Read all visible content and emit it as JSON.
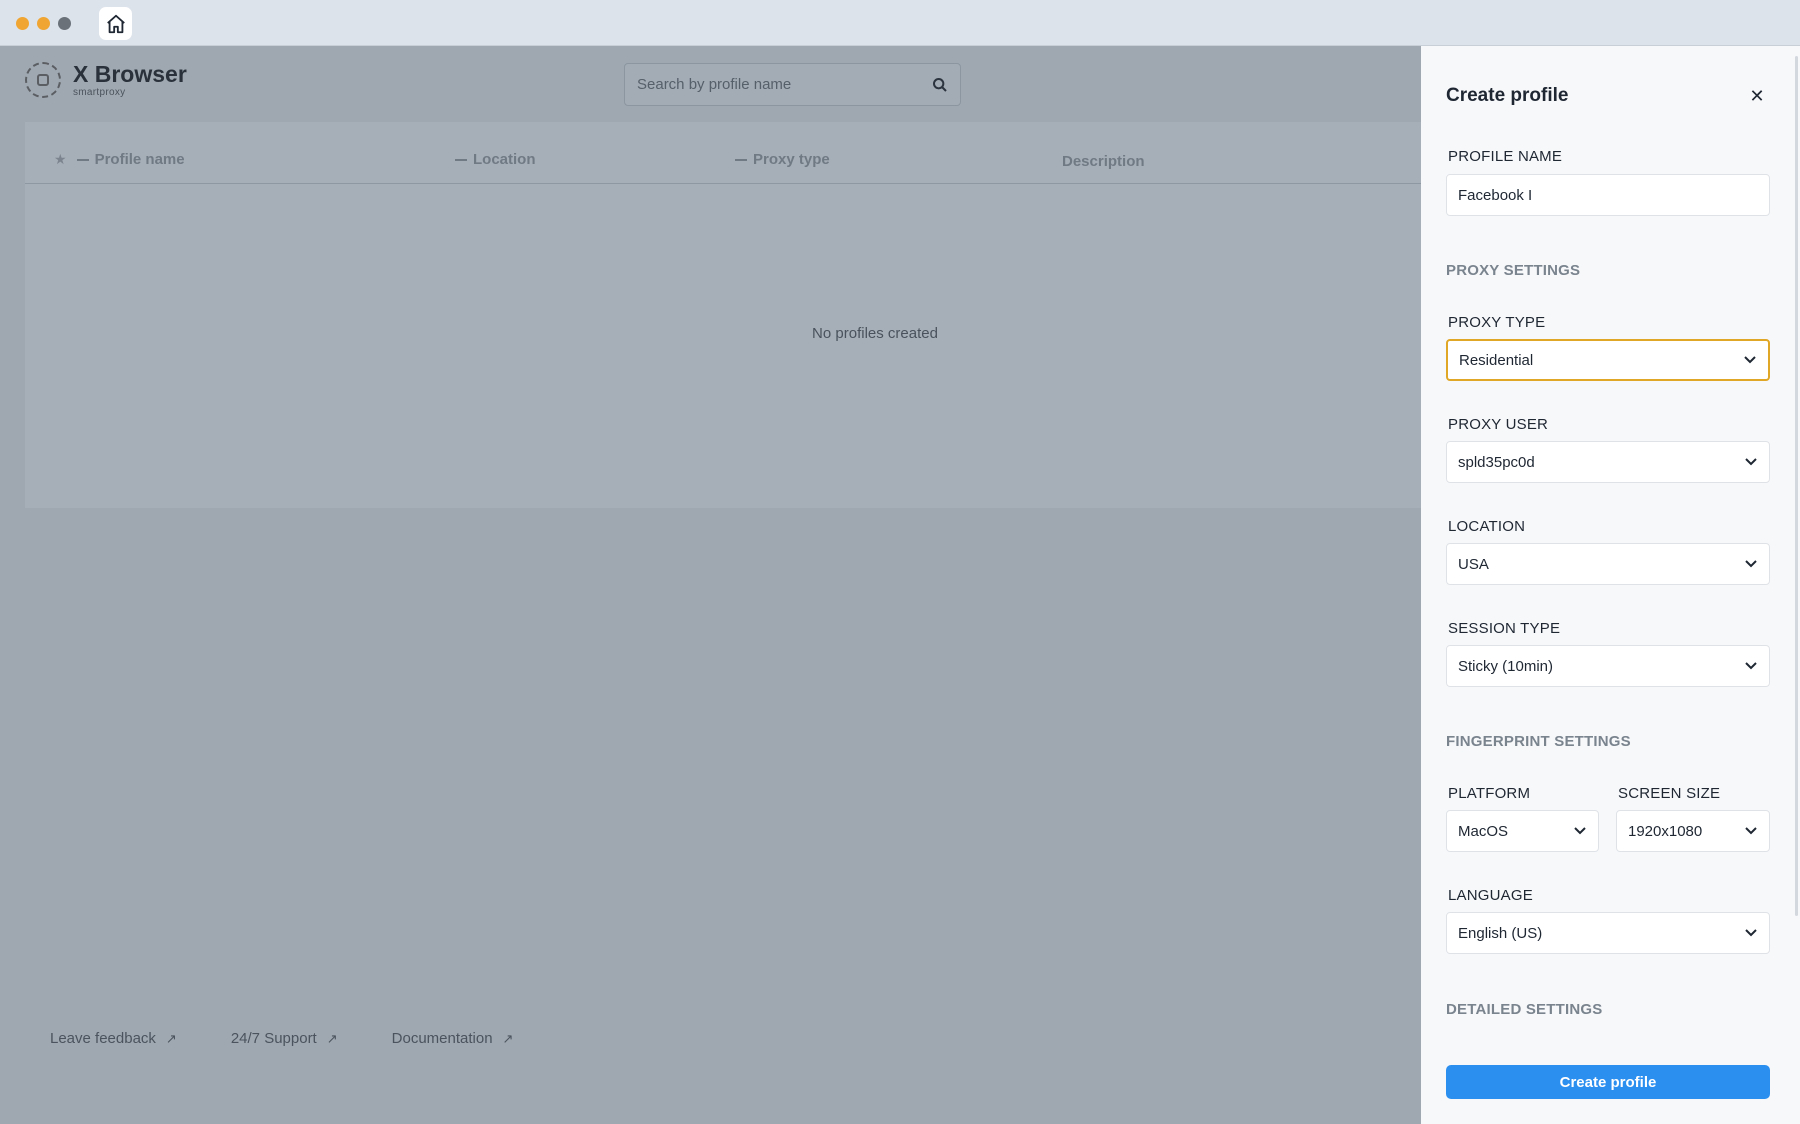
{
  "window": {
    "traffic_lights": [
      "#f0a532",
      "#f0a532",
      "#6b7178"
    ],
    "home_icon": "home-icon"
  },
  "app": {
    "logo": {
      "title": "X Browser",
      "subtitle": "smartproxy"
    },
    "search": {
      "placeholder": "Search by profile name"
    },
    "table": {
      "columns": [
        "Profile name",
        "Location",
        "Proxy type",
        "Description"
      ],
      "empty_message": "No profiles created"
    },
    "footer": {
      "links": [
        "Leave feedback",
        "24/7 Support",
        "Documentation"
      ]
    }
  },
  "panel": {
    "title": "Create profile",
    "profile_name": {
      "label": "PROFILE NAME",
      "value": "Facebook I"
    },
    "proxy_settings_title": "PROXY SETTINGS",
    "proxy_type": {
      "label": "PROXY TYPE",
      "value": "Residential"
    },
    "proxy_user": {
      "label": "PROXY USER",
      "value": "spld35pc0d"
    },
    "location": {
      "label": "LOCATION",
      "value": "USA"
    },
    "session_type": {
      "label": "SESSION TYPE",
      "value": "Sticky (10min)"
    },
    "fingerprint_settings_title": "FINGERPRINT SETTINGS",
    "platform": {
      "label": "PLATFORM",
      "value": "MacOS"
    },
    "screen_size": {
      "label": "SCREEN SIZE",
      "value": "1920x1080"
    },
    "language": {
      "label": "LANGUAGE",
      "value": "English (US)"
    },
    "detailed_settings_title": "DETAILED SETTINGS",
    "create_button": "Create profile"
  },
  "colors": {
    "accent_blue": "#2b8ff0",
    "focus_border": "#e0a626",
    "overlay": "#9fa8b1"
  }
}
